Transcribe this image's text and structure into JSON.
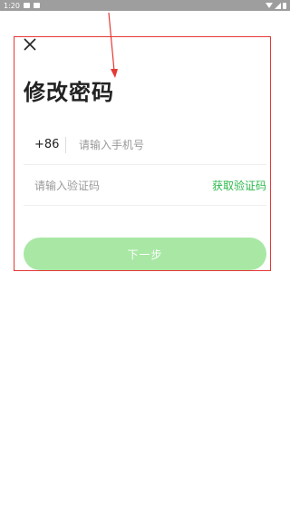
{
  "status_bar": {
    "time": "1:20"
  },
  "header": {
    "close_icon": "close-icon",
    "title": "修改密码"
  },
  "form": {
    "country_code": "+86",
    "phone_placeholder": "请输入手机号",
    "code_placeholder": "请输入验证码",
    "get_code_label": "获取验证码"
  },
  "actions": {
    "next_label": "下一步"
  },
  "colors": {
    "accent": "#2db84b",
    "button_disabled": "#a8e8a4",
    "annotation": "#e53935"
  }
}
